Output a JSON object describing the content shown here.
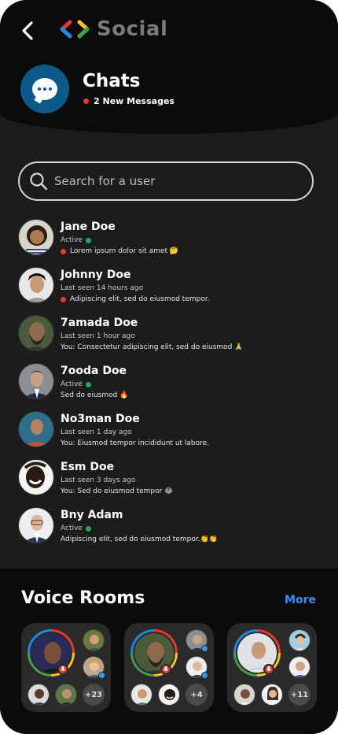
{
  "header": {
    "brand": "Social",
    "title": "Chats",
    "new_messages": "2 New Messages"
  },
  "search": {
    "placeholder": "Search for a user",
    "value": ""
  },
  "chats": [
    {
      "name": "Jane Doe",
      "status": "Active",
      "online": true,
      "preview": "Lorem ipsum dolor sit amet 🤔",
      "unread": true
    },
    {
      "name": "Johnny Doe",
      "status": "Last seen 14 hours ago",
      "online": false,
      "preview": "Adipiscing elit, sed do eiusmod tempor.",
      "unread": true
    },
    {
      "name": "7amada Doe",
      "status": "Last seen 1 hour ago",
      "online": false,
      "preview": "You: Consectetur adipiscing elit, sed do eiusmod 🙏",
      "unread": false
    },
    {
      "name": "7ooda Doe",
      "status": "Active",
      "online": true,
      "preview": "Sed do eiusmod 🔥",
      "unread": false
    },
    {
      "name": "No3man Doe",
      "status": "Last seen 1 day ago",
      "online": false,
      "preview": "You: Eiusmod tempor incididunt ut labore.",
      "unread": false
    },
    {
      "name": "Esm Doe",
      "status": "Last seen 3 days ago",
      "online": false,
      "preview": "You: Sed do eiusmod tempor 😂",
      "unread": false
    },
    {
      "name": "Bny Adam",
      "status": "Active",
      "online": true,
      "preview": "Adipiscing elit, sed do eiusmod tempor.👏👏",
      "unread": false
    }
  ],
  "voice_rooms": {
    "title": "Voice Rooms",
    "more_label": "More",
    "rooms": [
      {
        "extra_count": "+23"
      },
      {
        "extra_count": "+4"
      },
      {
        "extra_count": "+11"
      }
    ]
  },
  "colors": {
    "accent": "#3d8ef5",
    "unread_dot": "#e53935",
    "online_dot": "#1faa59",
    "chat_icon_bg": "#0b5a8a"
  }
}
